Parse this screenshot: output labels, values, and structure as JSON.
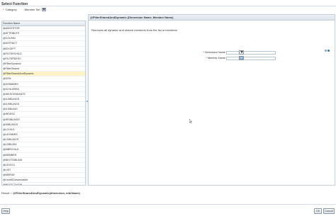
{
  "dialog": {
    "title": "Select Function"
  },
  "filter": {
    "category_label": "Category",
    "member_set_label": "Member Set",
    "required_marker": "*"
  },
  "list": {
    "column_header": "Function Name",
    "items": [
      "@ANCESTOR",
      "@ATTRIBUTE",
      "@COUSIN",
      "@DISTINCT",
      "@EXCEPT",
      "@FILTERCHILD",
      "@FILTERDESC",
      "@FilterDynamic",
      "@FilterShared",
      "@FilterSharedAndDynamic",
      "@GEN",
      "@GENMBRS",
      "@ICHILDREN",
      "@IDESCENDANTS",
      "@ILSIBLINGS",
      "@ILSIBLINGS",
      "@ILSIBLING",
      "@IRDESC",
      "@IRSIBLINGS",
      "@ISIBLINGS",
      "@LCHILD",
      "@LEVMBRS",
      "@LSIBLINGS",
      "@LSIBLING",
      "@MBRCHILD",
      "@MEMBER",
      "@NEXTSIBLING",
      "@LEVEL0",
      "@LIST",
      "@MERGE",
      "@Level0Descendants",
      "@NEXTCOUSIN",
      "@NEXTMBR",
      "@PARENT",
      "@PREVMBR",
      "@RDESCENDANTS",
      "@RSIBLINGS",
      "@SIBLINGS",
      "@UDA",
      "@WITHATTR"
    ],
    "selected_index": 9
  },
  "panel": {
    "header": "@FilterSharedAndDynamic (Dimension Name, Member Name)",
    "description": "Removes all dynamic and shared members from the list of members",
    "dimension_label": "Dimension Name",
    "member_label": "Member Name",
    "required_marker": "*"
  },
  "result": {
    "label": "Result",
    "sep": "=",
    "value": "@FilterSharedAndDynamic(dimension, mbrName)"
  },
  "buttons": {
    "help": "Help",
    "ok": "OK",
    "cancel": "Cancel"
  }
}
